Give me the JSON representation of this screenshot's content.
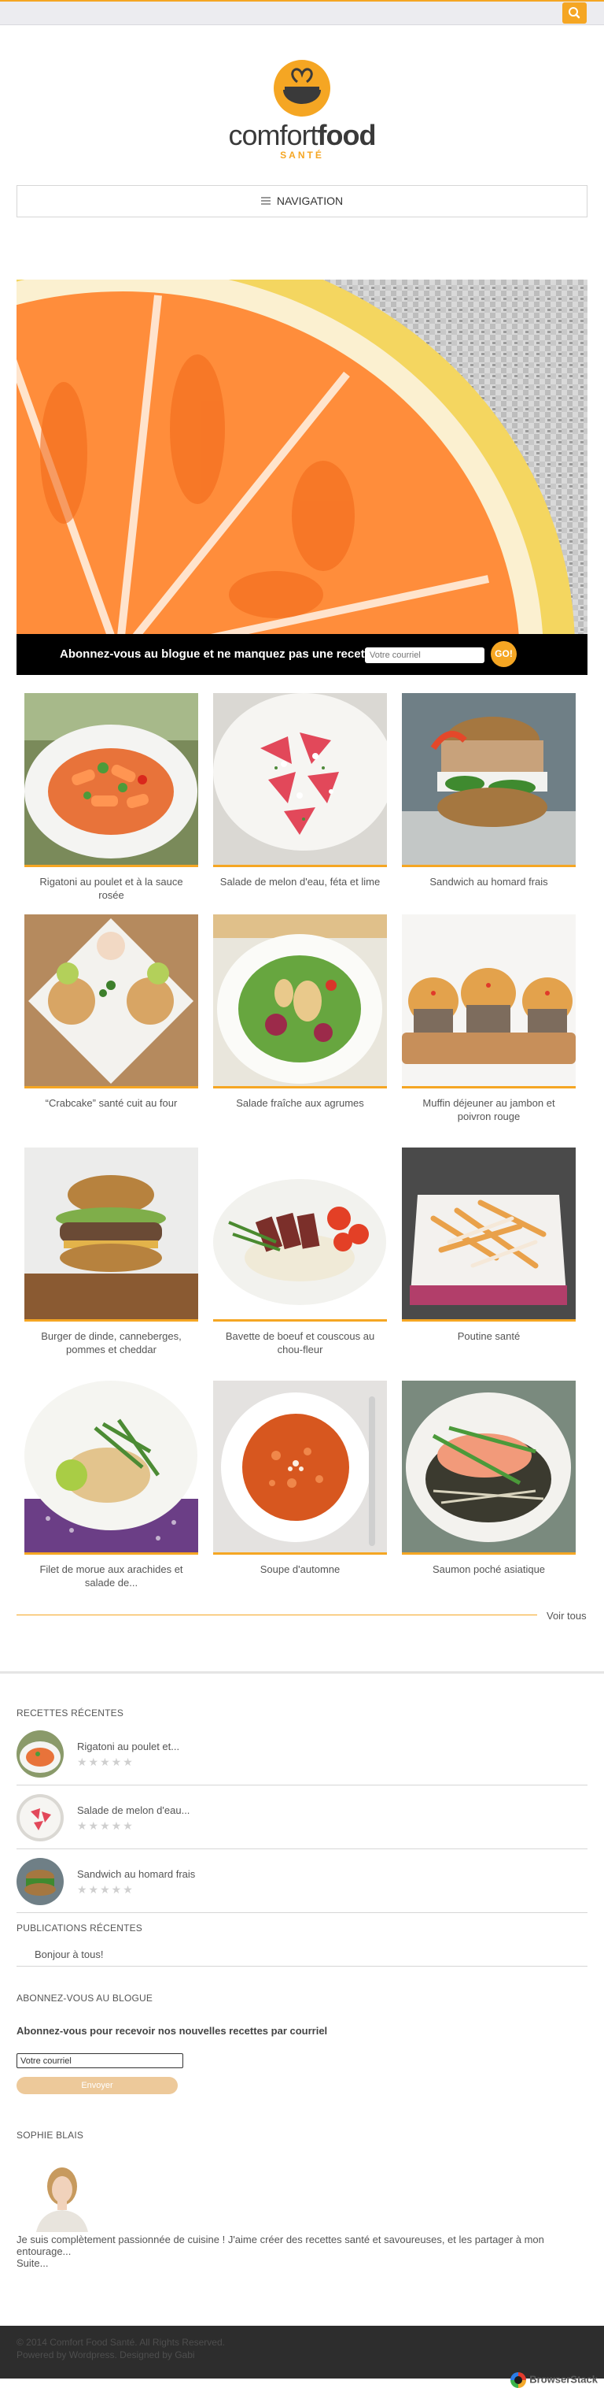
{
  "colors": {
    "accent": "#f5a623",
    "footer_bg": "#2d2d2d",
    "subscribe_bar_bg": "#000000"
  },
  "header": {
    "search_icon": "search-icon"
  },
  "logo": {
    "text_regular": "comfort",
    "text_bold": "food",
    "subtitle": "SANTÉ"
  },
  "nav": {
    "label": "NAVIGATION",
    "icon": "menu-icon"
  },
  "subscribe_bar": {
    "text": "Abonnez-vous au blogue et ne manquez pas une recette!",
    "placeholder": "Votre courriel",
    "go_label": "GO!"
  },
  "recipes": [
    {
      "title": "Rigatoni au poulet et à la sauce rosée"
    },
    {
      "title": "Salade de melon d'eau, féta et lime"
    },
    {
      "title": "Sandwich au homard frais"
    },
    {
      "title": "“Crabcake” santé cuit au four"
    },
    {
      "title": "Salade fraîche aux agrumes"
    },
    {
      "title": "Muffin déjeuner au jambon et poivron rouge"
    },
    {
      "title": "Burger de dinde, canneberges, pommes et cheddar"
    },
    {
      "title": "Bavette de boeuf et couscous au chou-fleur"
    },
    {
      "title": "Poutine santé"
    },
    {
      "title": "Filet de morue aux arachides et salade de..."
    },
    {
      "title": "Soupe d'automne"
    },
    {
      "title": "Saumon poché asiatique"
    }
  ],
  "voir_tous": "Voir tous",
  "sidebar": {
    "recent_recipes": {
      "heading": "RECETTES RÉCENTES",
      "items": [
        {
          "title": "Rigatoni au poulet et...",
          "stars": "★★★★★"
        },
        {
          "title": "Salade de melon d'eau...",
          "stars": "★★★★★"
        },
        {
          "title": "Sandwich au homard frais",
          "stars": "★★★★★"
        }
      ]
    },
    "recent_posts": {
      "heading": "PUBLICATIONS RÉCENTES",
      "items": [
        {
          "title": "Bonjour à tous!"
        }
      ]
    },
    "subscribe": {
      "heading": "ABONNEZ-VOUS AU BLOGUE",
      "subheading": "Abonnez-vous pour recevoir nos nouvelles recettes par courriel",
      "input_value": "Votre courriel",
      "button_label": "Envoyer"
    },
    "about": {
      "heading": "SOPHIE BLAIS",
      "bio": "Je suis complètement passionnée de cuisine ! J'aime créer des recettes santé et savoureuses, et les partager à mon entourage...",
      "more": "Suite..."
    }
  },
  "footer": {
    "line1": "© 2014 Comfort Food Santé. All Rights Reserved.",
    "line2": "Powered by Wordpress. Designed by Gabi"
  },
  "badge": {
    "label": "BrowserStack"
  }
}
